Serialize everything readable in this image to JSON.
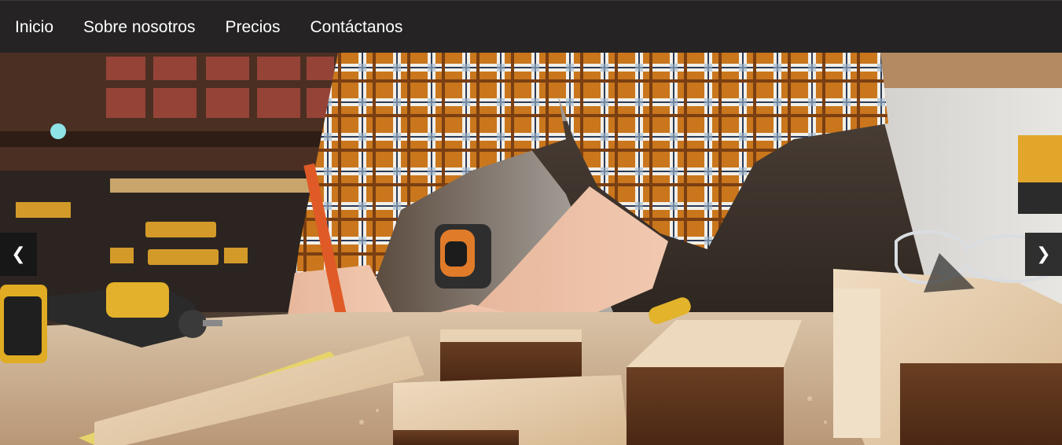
{
  "nav": {
    "items": [
      {
        "label": "Inicio"
      },
      {
        "label": "Sobre nosotros"
      },
      {
        "label": "Precios"
      },
      {
        "label": "Contáctanos"
      }
    ]
  },
  "slider": {
    "prev_label": "❮",
    "next_label": "❯"
  },
  "colors": {
    "navbar_bg": "#252324",
    "nav_text": "#ffffff",
    "arrow_bg": "#161616"
  },
  "icons": {
    "prev": "chevron-left-icon",
    "next": "chevron-right-icon"
  }
}
